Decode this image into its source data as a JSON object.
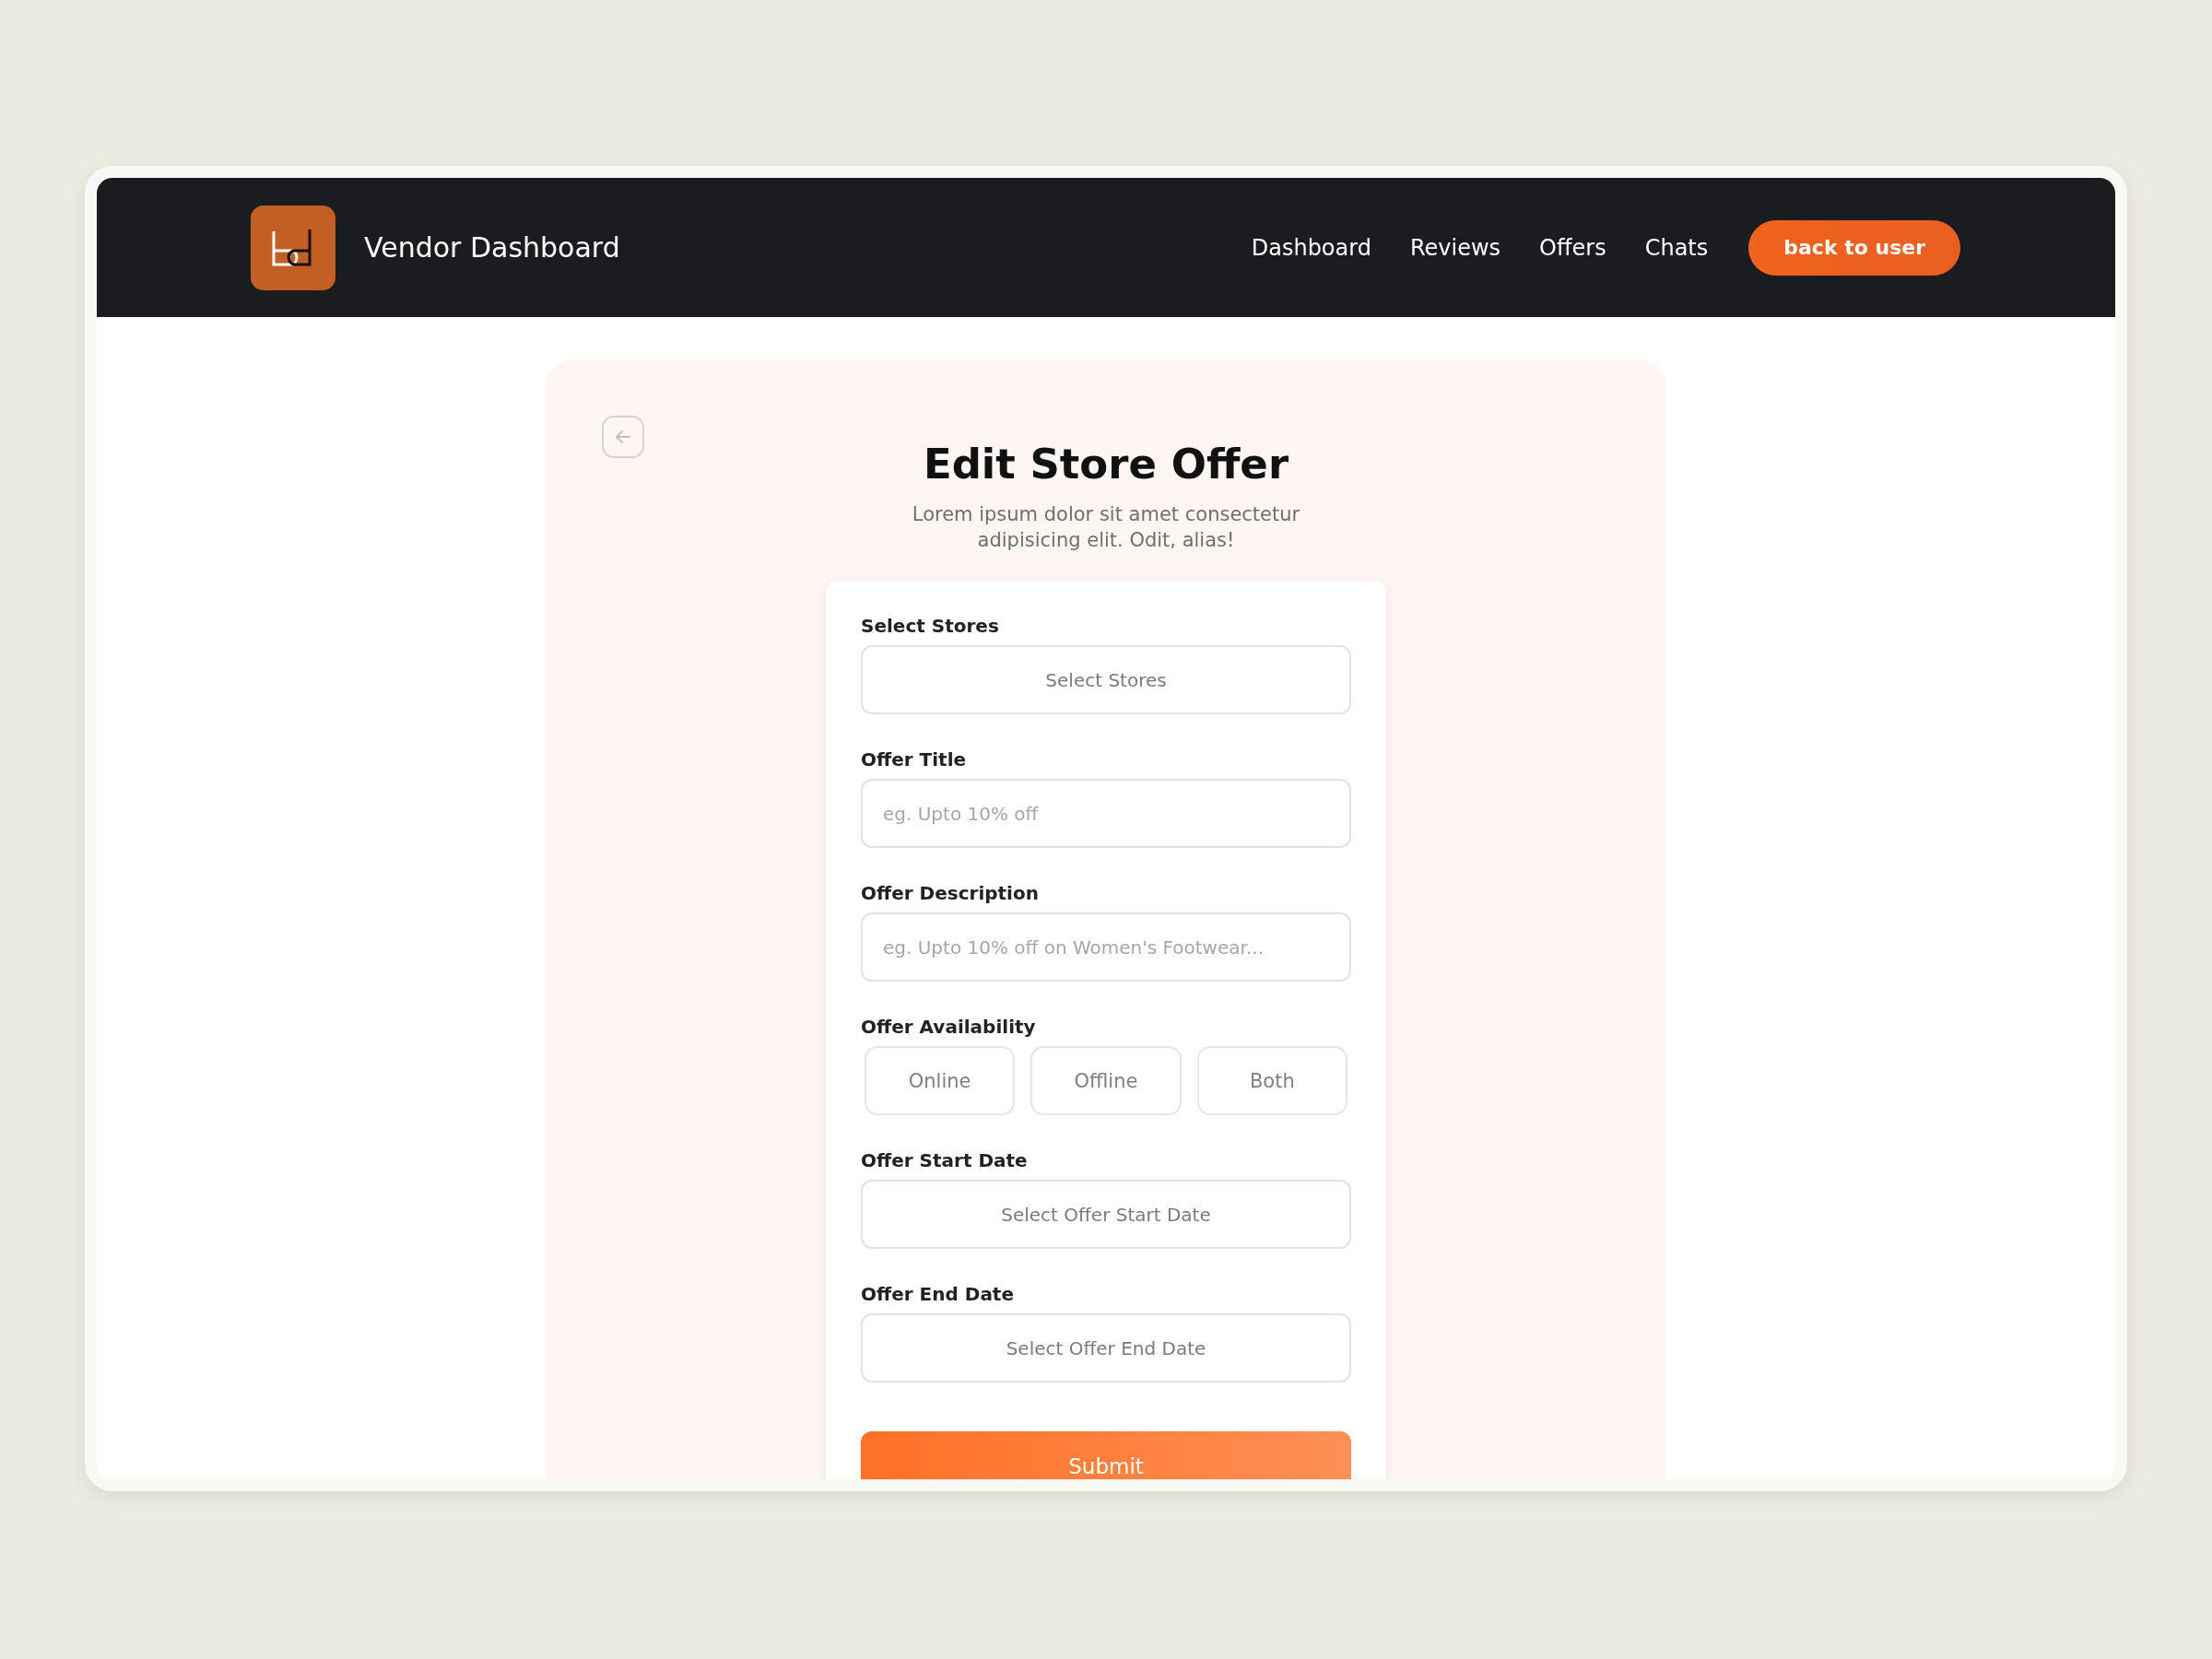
{
  "header": {
    "title": "Vendor Dashboard",
    "nav": [
      {
        "label": "Dashboard"
      },
      {
        "label": "Reviews"
      },
      {
        "label": "Offers"
      },
      {
        "label": "Chats"
      }
    ],
    "action": "back to user"
  },
  "page": {
    "title": "Edit Store Offer",
    "subtitle": "Lorem ipsum dolor sit amet consectetur adipisicing elit. Odit, alias!"
  },
  "form": {
    "fields": [
      {
        "kind": "select",
        "label": "Select Stores",
        "placeholder": "Select Stores"
      },
      {
        "kind": "text",
        "label": "Offer Title",
        "placeholder": "eg. Upto 10% off"
      },
      {
        "kind": "text",
        "label": "Offer Description",
        "placeholder": "eg. Upto 10% off on Women's Footwear..."
      },
      {
        "kind": "choice",
        "label": "Offer Availability",
        "options": [
          {
            "label": "Online",
            "selected": false
          },
          {
            "label": "Offline",
            "selected": false
          },
          {
            "label": "Both",
            "selected": false
          }
        ]
      },
      {
        "kind": "select",
        "label": "Offer Start Date",
        "placeholder": "Select Offer Start Date"
      },
      {
        "kind": "select",
        "label": "Offer End Date",
        "placeholder": "Select Offer End Date"
      }
    ],
    "submit": "Submit"
  }
}
